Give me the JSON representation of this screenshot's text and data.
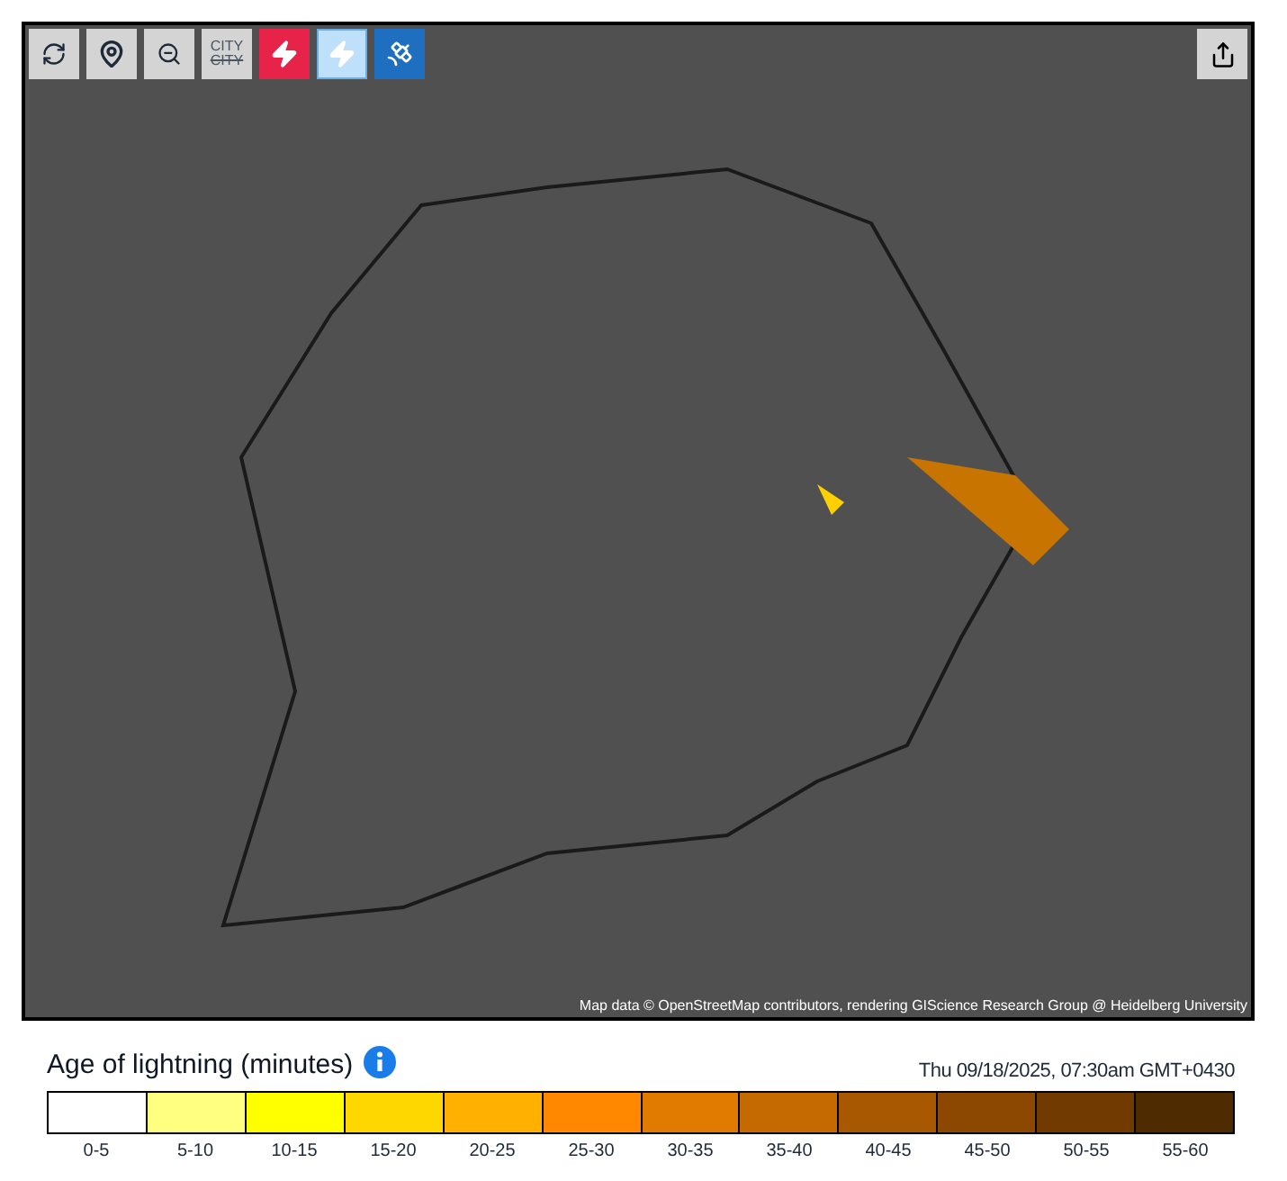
{
  "toolbar": [
    {
      "kind": "refresh",
      "active": false
    },
    {
      "kind": "location",
      "active": false
    },
    {
      "kind": "zoom",
      "active": false
    },
    {
      "kind": "city",
      "active": false,
      "labels": [
        "CITY",
        "CITY"
      ]
    },
    {
      "kind": "lightning",
      "active": true
    },
    {
      "kind": "ground-strike",
      "active": true
    },
    {
      "kind": "satellite",
      "active": true
    }
  ],
  "map": {
    "attribution": "Map data © OpenStreetMap contributors, rendering GIScience Research Group @ Heidelberg University"
  },
  "legend": {
    "title": "Age of lightning (minutes)",
    "timestamp": "Thu 09/18/2025, 07:30am GMT+0430",
    "bins": [
      {
        "label": "0-5",
        "color": "#ffffff"
      },
      {
        "label": "5-10",
        "color": "#ffff80"
      },
      {
        "label": "10-15",
        "color": "#ffff00"
      },
      {
        "label": "15-20",
        "color": "#ffd700"
      },
      {
        "label": "20-25",
        "color": "#ffb000"
      },
      {
        "label": "25-30",
        "color": "#ff8800"
      },
      {
        "label": "30-35",
        "color": "#e07b00"
      },
      {
        "label": "35-40",
        "color": "#c46a00"
      },
      {
        "label": "40-45",
        "color": "#a85800"
      },
      {
        "label": "45-50",
        "color": "#8c4800"
      },
      {
        "label": "50-55",
        "color": "#703a00"
      },
      {
        "label": "55-60",
        "color": "#4e2b00"
      }
    ]
  }
}
